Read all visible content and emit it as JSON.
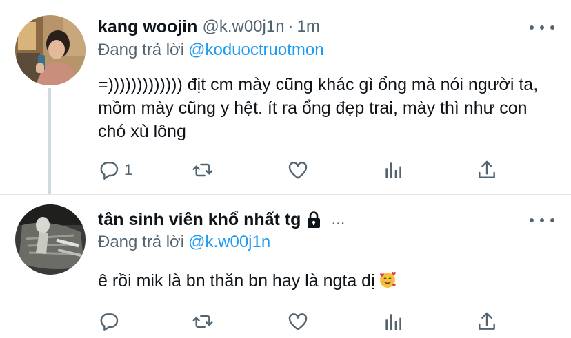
{
  "tweets": [
    {
      "display_name": "kang woojin",
      "handle": "@k.w00j1n",
      "separator": "·",
      "time": "1m",
      "replying_prefix": "Đang trả lời",
      "replying_to": "@koduoctruotmon",
      "text": "=)))))))))))))  địt cm mày cũng khác gì ổng mà nói người ta, mồm mày cũng y hệt. ít ra ổng đẹp trai, mày thì như con chó xù lông",
      "reply_count": "1",
      "has_thread_line": true
    },
    {
      "display_name": "tân sinh viên khổ nhất tg",
      "protected_icon": "lock-icon",
      "name_truncation": "...",
      "replying_prefix": "Đang trả lời",
      "replying_to": "@k.w00j1n",
      "text": "ê rồi mik là bn thăn bn hay là ngta dị",
      "emoji": "smiling-face-with-hearts",
      "reply_count": ""
    }
  ],
  "icons": {
    "reply": "reply-icon",
    "retweet": "retweet-icon",
    "like": "like-icon",
    "analytics": "analytics-icon",
    "share": "share-icon",
    "more": "more-options-icon"
  },
  "colors": {
    "text": "#0f1419",
    "secondary": "#536471",
    "mention": "#1d9bf0",
    "thread_line": "#cfd9de",
    "divider": "#e1e6ea"
  }
}
